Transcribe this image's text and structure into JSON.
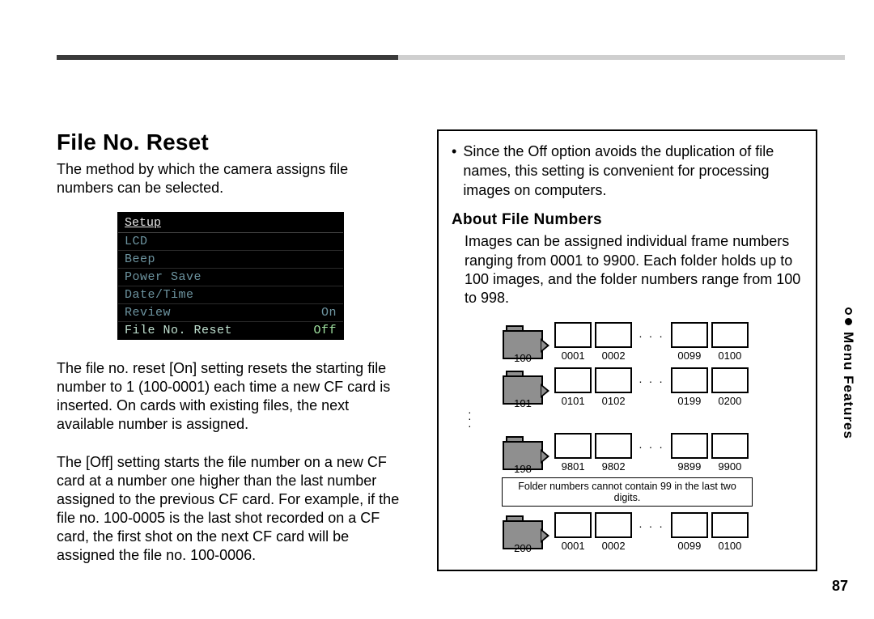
{
  "header": {
    "title": "File No. Reset"
  },
  "left": {
    "intro": "The method by which the camera assigns file numbers can be selected.",
    "lcd": {
      "title": "Setup",
      "rows": [
        {
          "k": "LCD",
          "v": ""
        },
        {
          "k": "Beep",
          "v": ""
        },
        {
          "k": "Power Save",
          "v": ""
        },
        {
          "k": "Date/Time",
          "v": ""
        },
        {
          "k": "Review",
          "v": "On"
        },
        {
          "k": "File No. Reset",
          "v": "Off",
          "selected": true
        }
      ]
    },
    "para1": "The file no. reset [On] setting resets the starting file number to 1 (100-0001) each time a new CF card is inserted. On cards with existing files, the next available number is assigned.",
    "para2": "The [Off] setting starts the file number on a new CF card at a number one higher than the last number assigned to the previous CF card. For example, if the file no. 100-0005 is the last shot recorded on a CF card, the first shot on the next CF card will be assigned the file no. 100-0006."
  },
  "right": {
    "bullet": "Since the Off option avoids the duplication of file names, this setting is convenient for processing images on computers.",
    "subhead": "About File Numbers",
    "subpara": "Images can be assigned individual frame numbers ranging from 0001 to 9900. Each folder holds up to 100 images, and the folder numbers range from 100 to 998.",
    "note": "Folder numbers cannot contain 99 in the last two digits.",
    "folders": [
      {
        "num": "100",
        "files": [
          "0001",
          "0002",
          "0099",
          "0100"
        ]
      },
      {
        "num": "101",
        "files": [
          "0101",
          "0102",
          "0199",
          "0200"
        ]
      },
      {
        "num": "198",
        "files": [
          "9801",
          "9802",
          "9899",
          "9900"
        ]
      },
      {
        "num": "200",
        "files": [
          "0001",
          "0002",
          "0099",
          "0100"
        ]
      }
    ]
  },
  "side": {
    "label": "Menu Features"
  },
  "page_number": "87"
}
